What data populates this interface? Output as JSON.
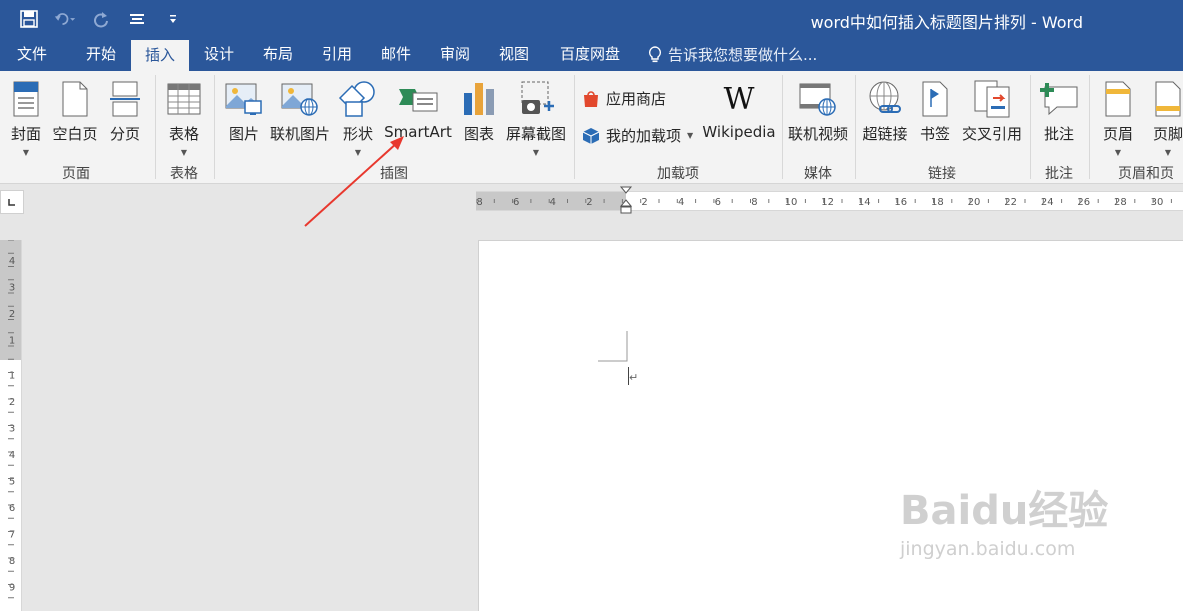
{
  "titlebar": {
    "title": "word中如何插入标题图片排列 - Word"
  },
  "tabs": [
    {
      "label": "文件"
    },
    {
      "label": "开始"
    },
    {
      "label": "插入"
    },
    {
      "label": "设计"
    },
    {
      "label": "布局"
    },
    {
      "label": "引用"
    },
    {
      "label": "邮件"
    },
    {
      "label": "审阅"
    },
    {
      "label": "视图"
    },
    {
      "label": "百度网盘"
    }
  ],
  "tellme": {
    "label": "告诉我您想要做什么..."
  },
  "ribbon": {
    "pages": {
      "cover": "封面",
      "blank": "空白页",
      "break": "分页",
      "group": "页面"
    },
    "tables": {
      "table": "表格",
      "group": "表格"
    },
    "illustrations": {
      "pictures": "图片",
      "online_pictures": "联机图片",
      "shapes": "形状",
      "smartart": "SmartArt",
      "chart": "图表",
      "screenshot": "屏幕截图",
      "group": "插图"
    },
    "addins": {
      "store": "应用商店",
      "my_addins": "我的加载项",
      "wikipedia": "Wikipedia",
      "group": "加载项"
    },
    "media": {
      "online_video": "联机视频",
      "group": "媒体"
    },
    "links": {
      "hyperlink": "超链接",
      "bookmark": "书签",
      "crossref": "交叉引用",
      "group": "链接"
    },
    "comments": {
      "comment": "批注",
      "group": "批注"
    },
    "header_footer": {
      "header": "页眉",
      "footer": "页脚",
      "group": "页眉和页"
    }
  },
  "hruler": {
    "left_ticks": [
      "8",
      "6",
      "4",
      "2"
    ],
    "right_ticks": [
      "2",
      "4",
      "6",
      "8",
      "10",
      "12",
      "14",
      "16",
      "18",
      "20",
      "22",
      "24",
      "26",
      "28",
      "30"
    ]
  },
  "vruler": {
    "top_ticks": [
      "4",
      "3",
      "2",
      "1"
    ],
    "bottom_ticks": [
      "1",
      "2",
      "3",
      "4",
      "5",
      "6",
      "7",
      "8",
      "9"
    ]
  },
  "watermark": {
    "brand": "Baidu经验",
    "url": "jingyan.baidu.com"
  }
}
